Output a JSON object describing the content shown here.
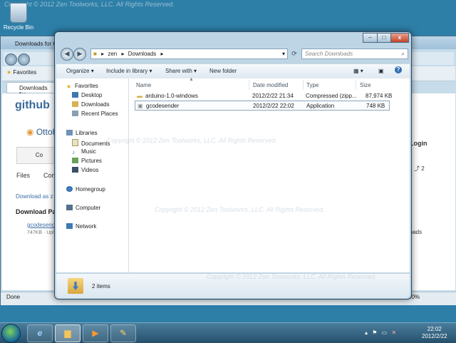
{
  "watermark": "Copyright © 2012 Zen Toolworks, LLC. All Rights Reserved.",
  "desktop": {
    "recycle_bin_label": "Recycle Bin"
  },
  "ie": {
    "title": "Downloads for O",
    "tab_label": "Downloads for",
    "favorites_label": "Favorites",
    "logo_text": "github",
    "repo_owner": "OttoHe",
    "login_text": "Login",
    "files_label": "Files",
    "commits_label": "Com",
    "download_as": "Download as z",
    "downloads_heading": "Download Pa",
    "download_link": "gcodesend",
    "download_meta": "747KB · Uplo",
    "downloads_right": "loads",
    "watch_count": "2",
    "c_label": "Co",
    "status_done": "Done",
    "zoom": "00%"
  },
  "explorer": {
    "breadcrumb": [
      "zen",
      "Downloads"
    ],
    "search_placeholder": "Search Downloads",
    "toolbar": {
      "organize": "Organize",
      "include": "Include in library",
      "share": "Share with",
      "new_folder": "New folder"
    },
    "nav": {
      "favorites": "Favorites",
      "desktop": "Desktop",
      "downloads": "Downloads",
      "recent": "Recent Places",
      "libraries": "Libraries",
      "documents": "Documents",
      "music": "Music",
      "pictures": "Pictures",
      "videos": "Videos",
      "homegroup": "Homegroup",
      "computer": "Computer",
      "network": "Network"
    },
    "columns": {
      "name": "Name",
      "date": "Date modified",
      "type": "Type",
      "size": "Size"
    },
    "files": [
      {
        "name": "arduino-1.0-windows",
        "date": "2012/2/22 21:34",
        "type": "Compressed (zipp...",
        "size": "87,974 KB"
      },
      {
        "name": "gcodesender",
        "date": "2012/2/22 22:02",
        "type": "Application",
        "size": "748 KB"
      }
    ],
    "item_count": "2 items"
  },
  "taskbar": {
    "time": "22:02",
    "date": "2012/2/22"
  }
}
